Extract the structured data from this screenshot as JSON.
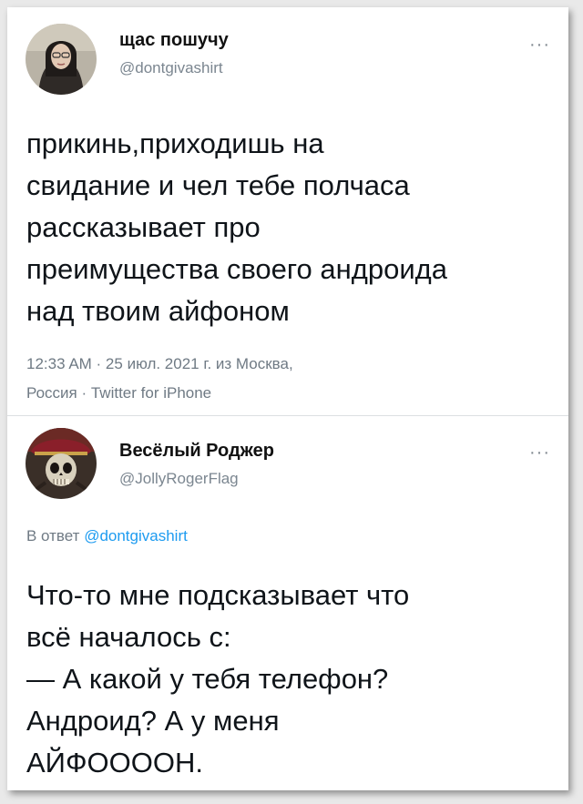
{
  "tweet1": {
    "author_name": "щас пошучу",
    "handle": "@dontgivashirt",
    "more_label": "···",
    "text_lines": [
      "прикинь,приходишь на",
      "свидание и чел тебе полчаса",
      "рассказывает про",
      "преимущества своего андроида",
      "над твоим айфоном"
    ],
    "meta_line1": "12:33 AM · 25 июл. 2021 г. из Москва,",
    "meta_line2": "Россия · Twitter for iPhone"
  },
  "tweet2": {
    "author_name": "Весёлый Роджер",
    "handle": "@JollyRogerFlag",
    "more_label": "···",
    "reply_prefix": "В ответ",
    "reply_mention": "@dontgivashirt",
    "text_lines": [
      "Что-то мне подсказывает что",
      "всё началось с:",
      "— А какой у тебя телефон?",
      "Андроид? А у меня",
      "АЙФООООН."
    ]
  },
  "colors": {
    "link": "#1d9bf0",
    "secondary_text": "#6f7a84",
    "primary_text": "#0f1419"
  }
}
